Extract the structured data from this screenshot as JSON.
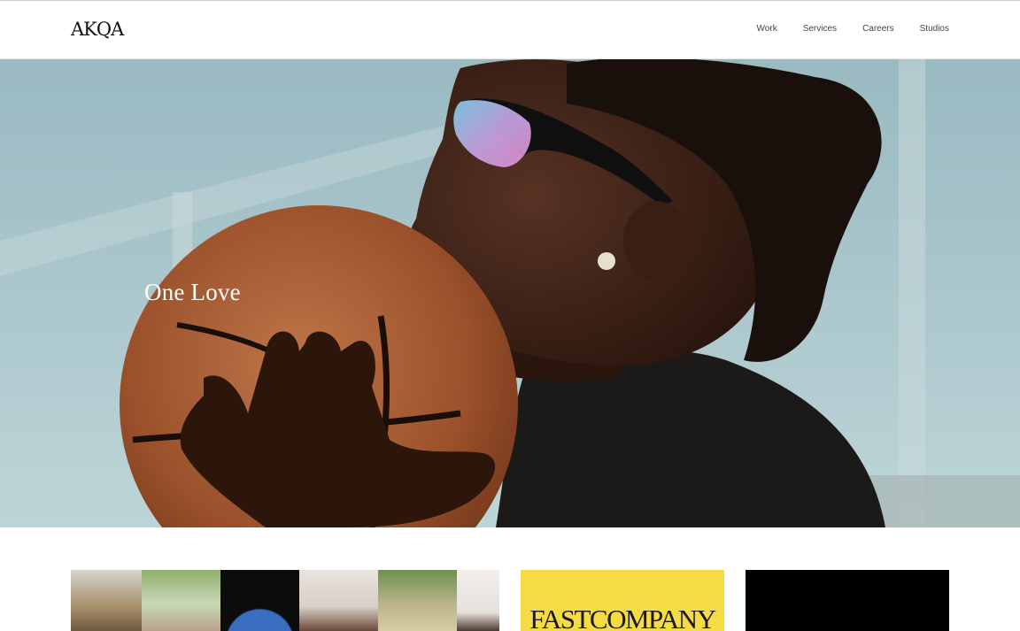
{
  "header": {
    "logo_text": "AKQA",
    "nav": [
      {
        "label": "Work"
      },
      {
        "label": "Services"
      },
      {
        "label": "Careers"
      },
      {
        "label": "Studios"
      }
    ]
  },
  "hero": {
    "title": "One Love"
  },
  "cards": {
    "mosaic_tiles": 6,
    "fastco": {
      "logo_text": "FASTCOMPANY",
      "bg_color": "#f5dc45"
    },
    "black": {
      "bg_color": "#000000"
    }
  },
  "colors": {
    "sky": "#b5d3d8",
    "basketball": "#a65a32",
    "skin": "#3f2418",
    "hoodie": "#1c1a18"
  }
}
